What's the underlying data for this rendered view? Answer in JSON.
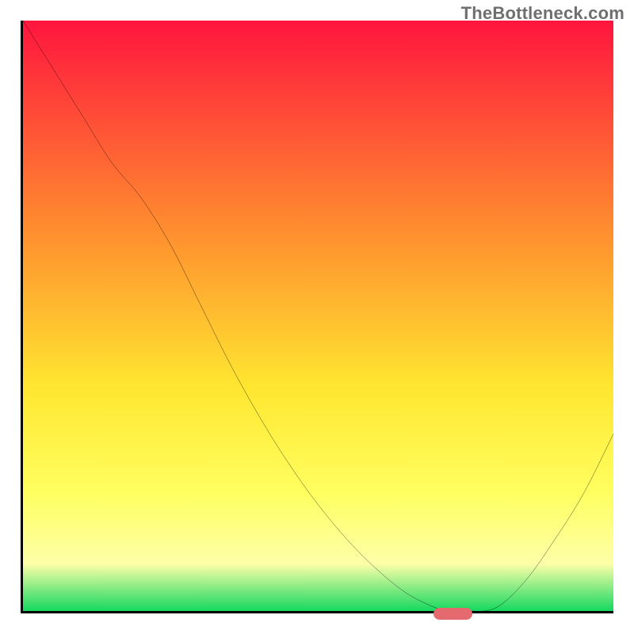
{
  "watermark": "TheBottleneck.com",
  "colors": {
    "gradient_top": "#ff153e",
    "gradient_mid1": "#ff8c2f",
    "gradient_mid2": "#ffe630",
    "gradient_mid3": "#ffff60",
    "gradient_mid4": "#fdffa8",
    "gradient_bottom": "#15d85f",
    "axis": "#000000",
    "curve": "#000000",
    "marker": "#e46a6f"
  },
  "chart_data": {
    "type": "line",
    "title": "",
    "xlabel": "",
    "ylabel": "",
    "x": [
      0.0,
      0.05,
      0.1,
      0.15,
      0.2,
      0.25,
      0.3,
      0.35,
      0.4,
      0.45,
      0.5,
      0.55,
      0.6,
      0.65,
      0.7,
      0.725,
      0.75,
      0.8,
      0.85,
      0.9,
      0.95,
      1.0
    ],
    "y": [
      1.0,
      0.92,
      0.84,
      0.76,
      0.7,
      0.62,
      0.52,
      0.42,
      0.33,
      0.25,
      0.18,
      0.12,
      0.07,
      0.03,
      0.005,
      0.0,
      0.0,
      0.005,
      0.05,
      0.12,
      0.2,
      0.3
    ],
    "xlim": [
      0,
      1
    ],
    "ylim": [
      0,
      1
    ],
    "marker": {
      "x_center": 0.725,
      "y": 0.0,
      "x_half_width": 0.035
    },
    "annotations": [],
    "legend": []
  }
}
